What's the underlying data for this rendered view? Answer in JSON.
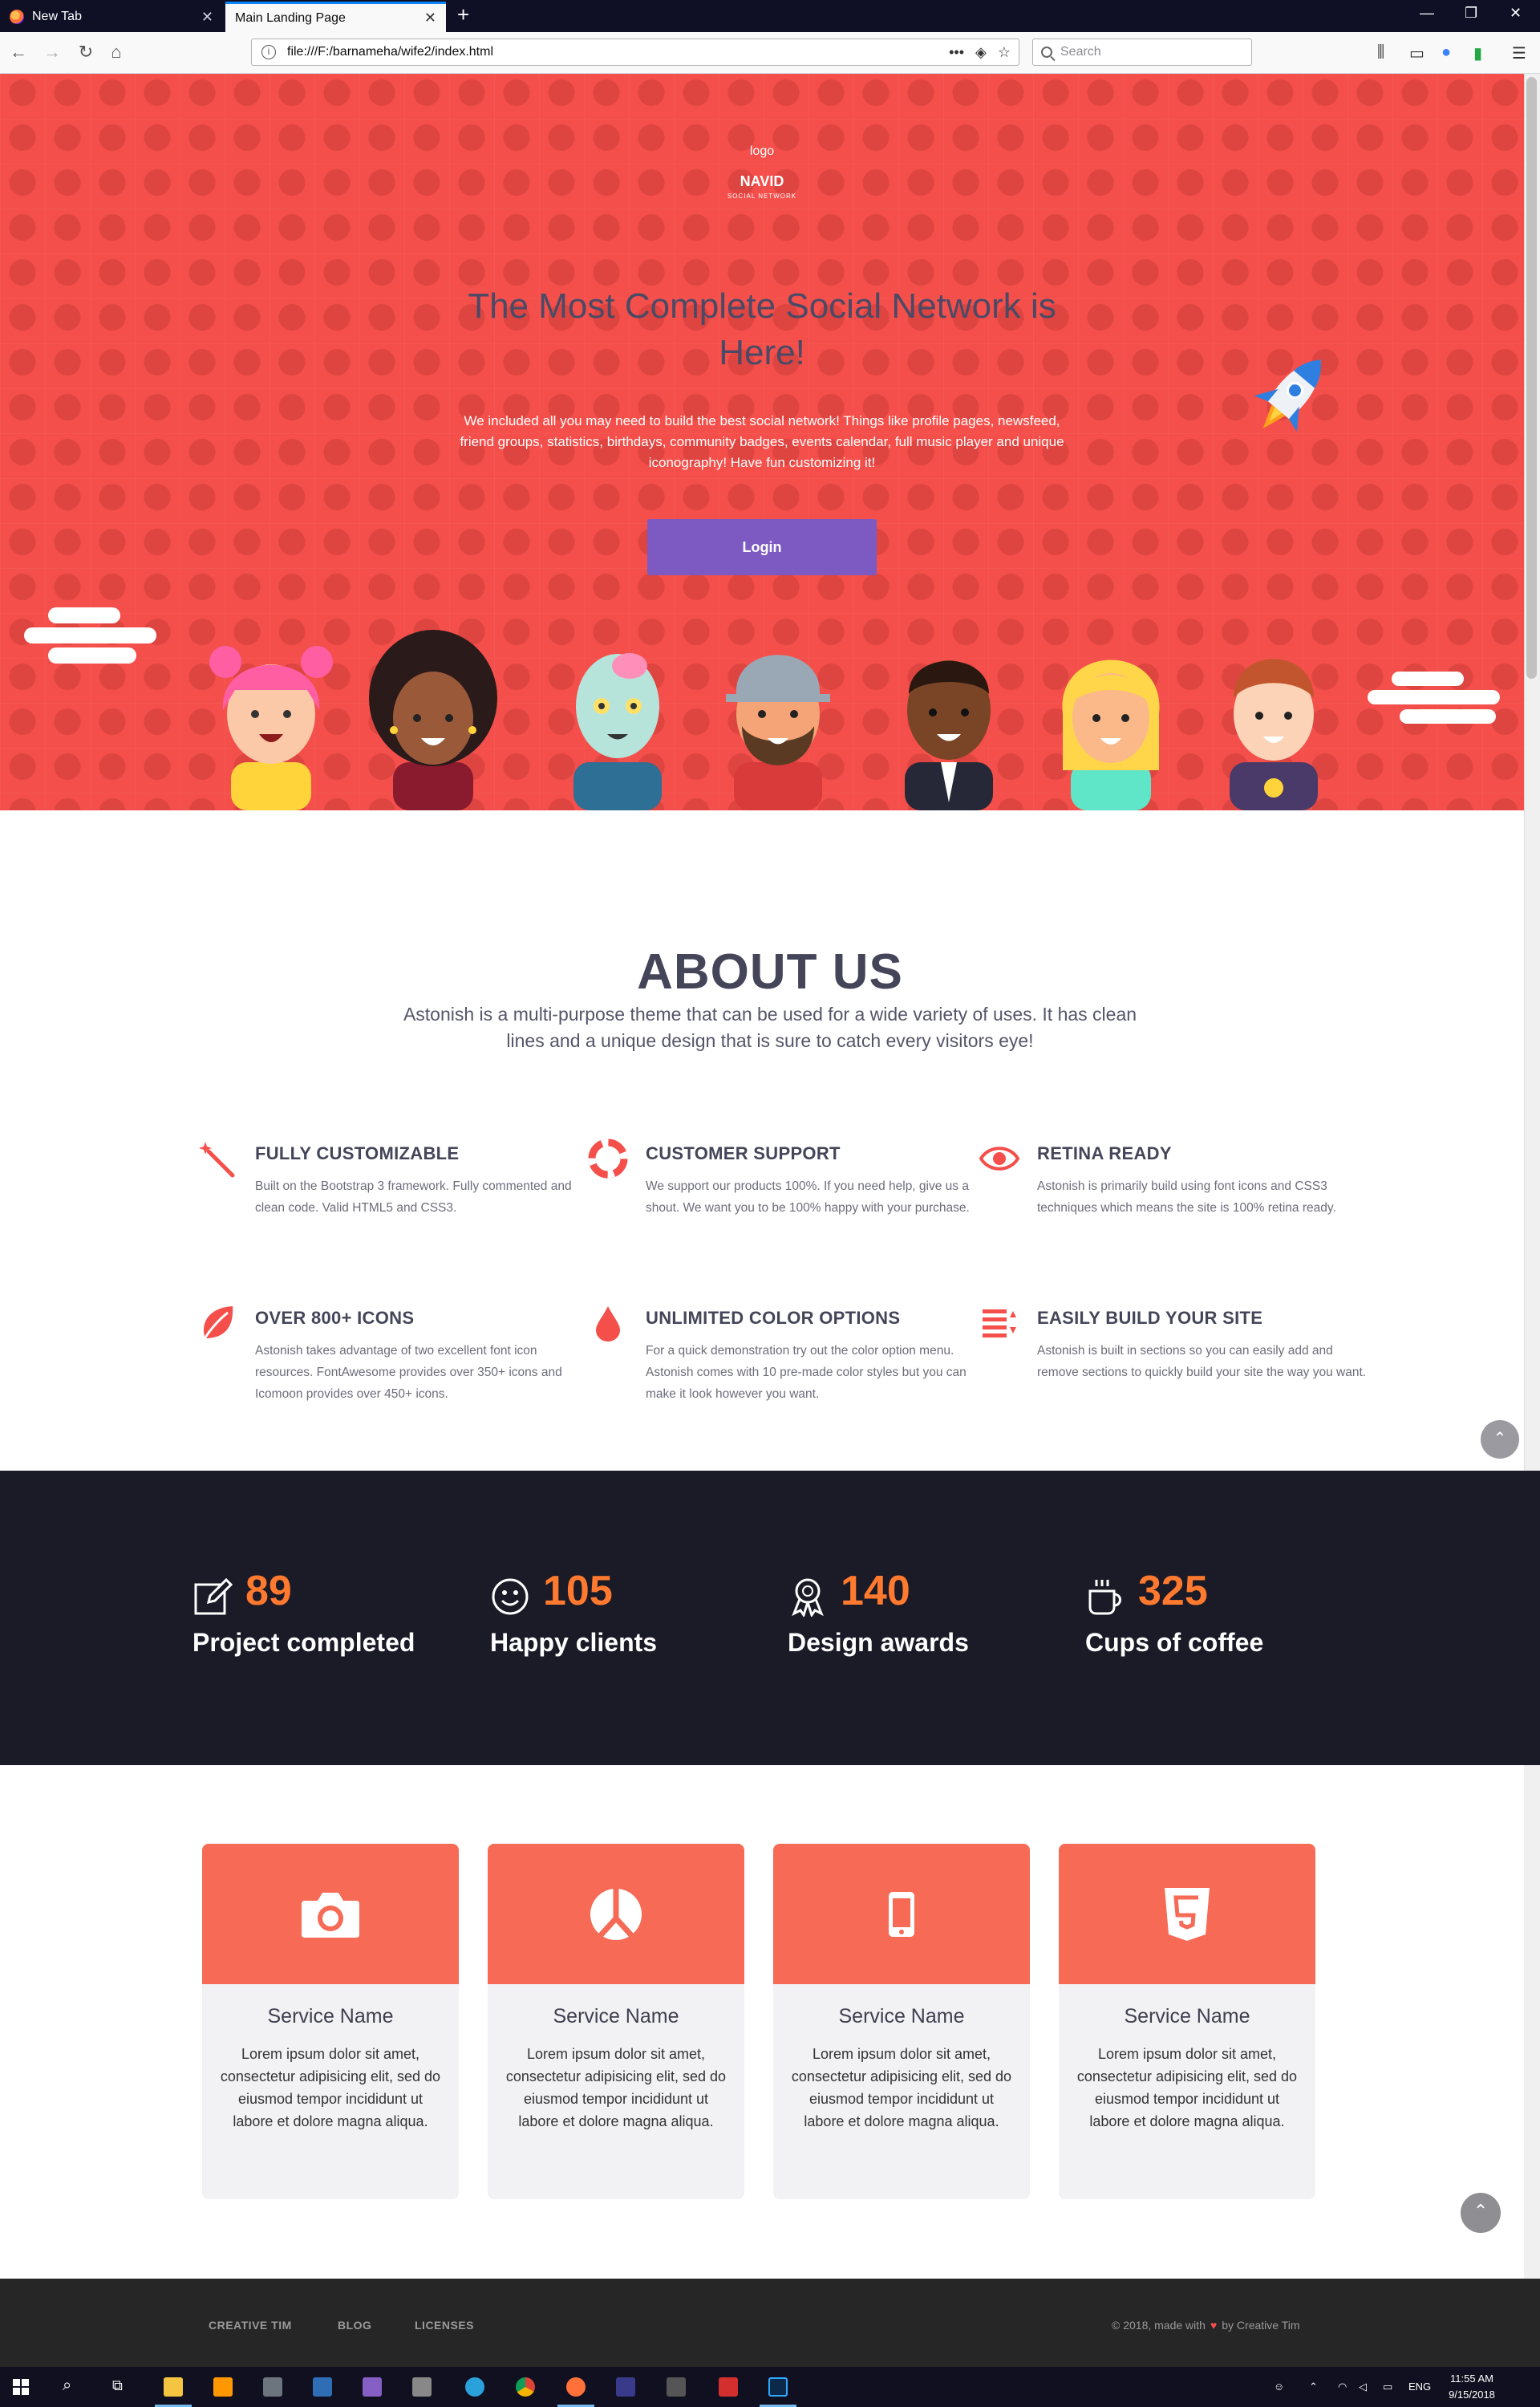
{
  "browser": {
    "tabs": [
      {
        "label": "New Tab",
        "active": false
      },
      {
        "label": "Main Landing Page",
        "active": true
      }
    ],
    "url": "file:///F:/barnameha/wife2/index.html",
    "search_placeholder": "Search"
  },
  "hero": {
    "logo_text": "logo",
    "brand": "NAVID",
    "brand_sub": "SOCIAL NETWORK",
    "title": "The Most Complete Social Network is Here!",
    "description": "We included all you may need to build the best social network! Things like profile pages, newsfeed, friend groups, statistics, birthdays, community badges, events calendar, full music player and unique iconography! Have fun customizing it!",
    "login_label": "Login",
    "colors": {
      "background": "#f44f4a",
      "button": "#7c5ac2",
      "title": "#4b4a66"
    }
  },
  "about": {
    "title": "ABOUT US",
    "description": "Astonish is a multi-purpose theme that can be used for a wide variety of uses. It has clean lines and a unique design that is sure to catch every visitors eye!",
    "features": [
      {
        "icon": "magic-wand-icon",
        "title": "FULLY CUSTOMIZABLE",
        "text": "Built on the Bootstrap 3 framework. Fully commented and clean code. Valid HTML5 and CSS3."
      },
      {
        "icon": "life-ring-icon",
        "title": "CUSTOMER SUPPORT",
        "text": "We support our products 100%. If you need help, give us a shout. We want you to be 100% happy with your purchase."
      },
      {
        "icon": "eye-icon",
        "title": "RETINA READY",
        "text": "Astonish is primarily build using font icons and CSS3 techniques which means the site is 100% retina ready."
      },
      {
        "icon": "leaf-icon",
        "title": "OVER 800+ ICONS",
        "text": "Astonish takes advantage of two excellent font icon resources. FontAwesome provides over 350+ icons and Icomoon provides over 450+ icons."
      },
      {
        "icon": "drop-icon",
        "title": "UNLIMITED COLOR OPTIONS",
        "text": "For a quick demonstration try out the color option menu. Astonish comes with 10 pre-made color styles but you can make it look however you want."
      },
      {
        "icon": "sort-list-icon",
        "title": "EASILY BUILD YOUR SITE",
        "text": "Astonish is built in sections so you can easily add and remove sections to quickly build your site the way you want."
      }
    ]
  },
  "stats": [
    {
      "icon": "edit-icon",
      "number": "89",
      "label": "Project completed"
    },
    {
      "icon": "smile-icon",
      "number": "105",
      "label": "Happy clients"
    },
    {
      "icon": "award-icon",
      "number": "140",
      "label": "Design awards"
    },
    {
      "icon": "coffee-icon",
      "number": "325",
      "label": "Cups of coffee"
    }
  ],
  "services": [
    {
      "icon": "camera-icon",
      "title": "Service Name",
      "text": "Lorem ipsum dolor sit amet, consectetur adipisicing elit, sed do eiusmod tempor incididunt ut labore et dolore magna aliqua."
    },
    {
      "icon": "peace-icon",
      "title": "Service Name",
      "text": "Lorem ipsum dolor sit amet, consectetur adipisicing elit, sed do eiusmod tempor incididunt ut labore et dolore magna aliqua."
    },
    {
      "icon": "mobile-icon",
      "title": "Service Name",
      "text": "Lorem ipsum dolor sit amet, consectetur adipisicing elit, sed do eiusmod tempor incididunt ut labore et dolore magna aliqua."
    },
    {
      "icon": "html5-icon",
      "title": "Service Name",
      "text": "Lorem ipsum dolor sit amet, consectetur adipisicing elit, sed do eiusmod tempor incididunt ut labore et dolore magna aliqua."
    }
  ],
  "footer": {
    "links": [
      "CREATIVE TIM",
      "BLOG",
      "LICENSES"
    ],
    "copyright_prefix": "© 2018, made with",
    "copyright_suffix": "by Creative Tim"
  },
  "taskbar": {
    "language": "ENG",
    "time": "11:55 AM",
    "date": "9/15/2018"
  }
}
